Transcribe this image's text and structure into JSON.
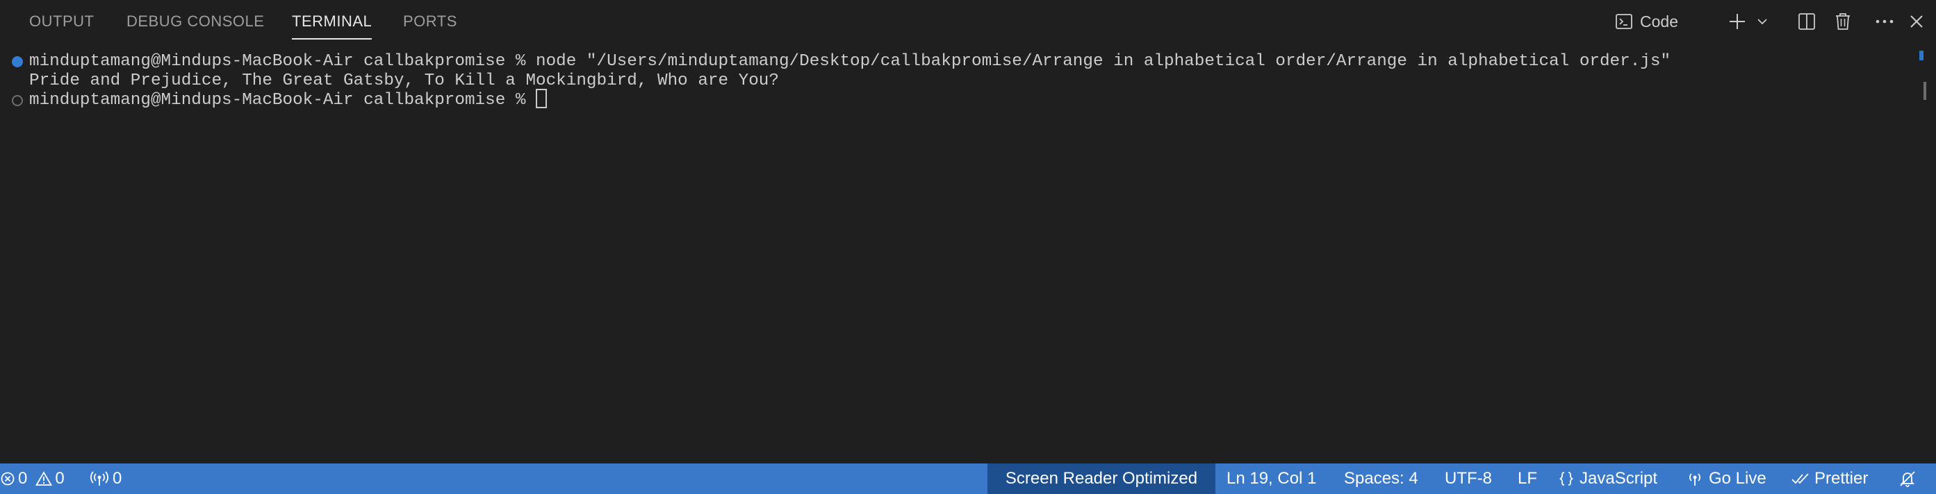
{
  "tabs": [
    {
      "label": "OUTPUT",
      "active": false
    },
    {
      "label": "DEBUG CONSOLE",
      "active": false
    },
    {
      "label": "TERMINAL",
      "active": true
    },
    {
      "label": "PORTS",
      "active": false
    }
  ],
  "actions": {
    "terminal_name": "Code",
    "terminal_icon": "terminal-icon",
    "add_icon": "plus-icon",
    "dropdown_icon": "chevron-down-icon",
    "split_icon": "split-editor-icon",
    "trash_icon": "trash-icon",
    "more_icon": "ellipsis-icon",
    "close_icon": "close-icon"
  },
  "terminal": {
    "lines": [
      {
        "decoration": "success",
        "text": "minduptamang@Mindups-MacBook-Air callbakpromise % node \"/Users/minduptamang/Desktop/callbakpromise/Arrange in alphabetical order/Arrange in alphabetical order.js\""
      },
      {
        "decoration": "none",
        "text": "Pride and Prejudice, The Great Gatsby, To Kill a Mockingbird, Who are You?"
      },
      {
        "decoration": "default",
        "text": "minduptamang@Mindups-MacBook-Air callbakpromise % "
      }
    ]
  },
  "statusbar": {
    "errors": "0",
    "warnings": "0",
    "ports": "0",
    "screen_reader": "Screen Reader Optimized",
    "position": "Ln 19, Col 1",
    "spaces": "Spaces: 4",
    "encoding": "UTF-8",
    "eol": "LF",
    "language": "JavaScript",
    "go_live": "Go Live",
    "prettier": "Prettier"
  },
  "colors": {
    "panel_bg": "#1f1f1f",
    "statusbar_bg": "#3a78c9",
    "screen_reader_bg": "#1d4f8f",
    "terminal_text": "#cccccc",
    "success_decoration": "#3794ff"
  }
}
